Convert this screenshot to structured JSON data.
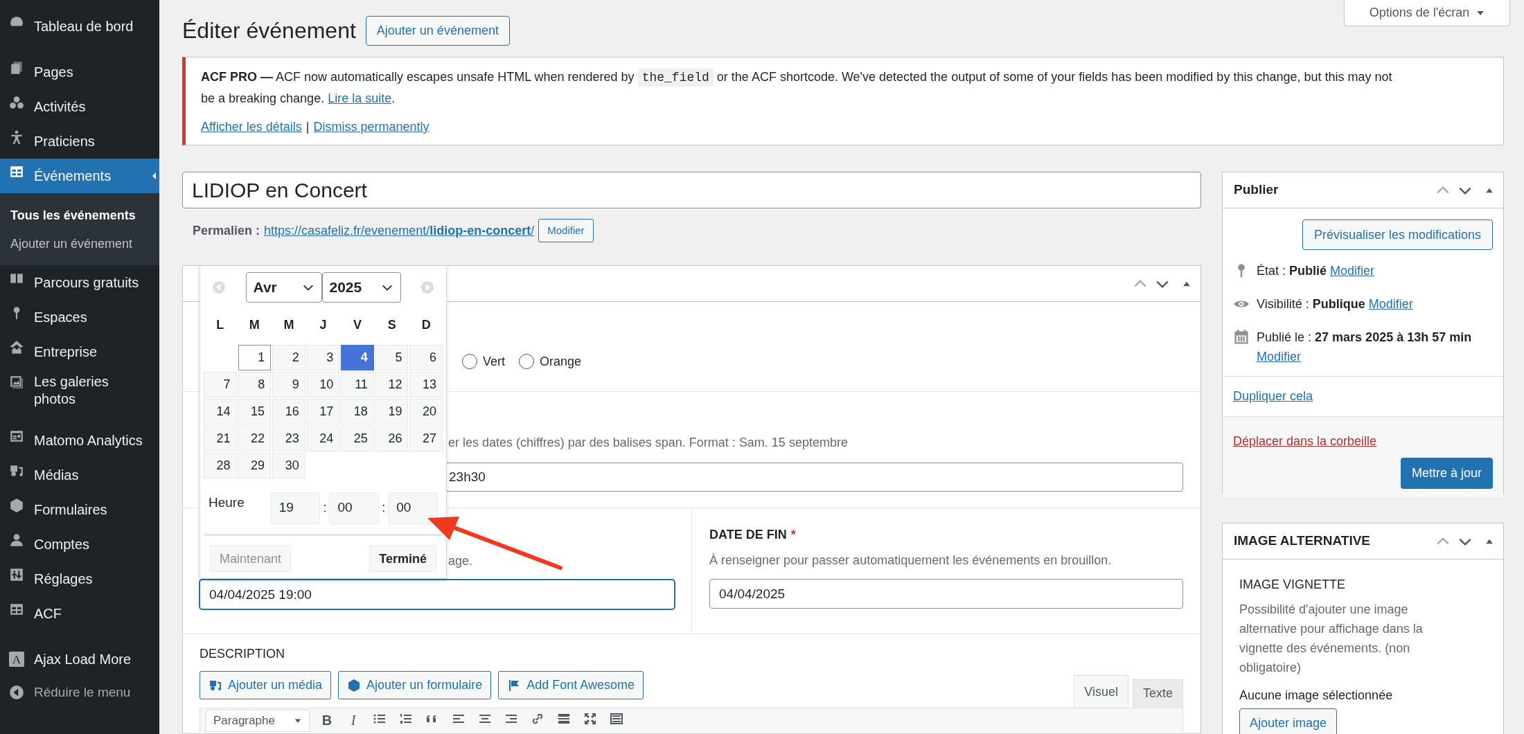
{
  "sidebar": {
    "groups": [
      [
        {
          "label": "Tableau de bord",
          "selected": false
        }
      ],
      [
        {
          "label": "Pages",
          "selected": false
        },
        {
          "label": "Activités",
          "selected": false
        },
        {
          "label": "Praticiens",
          "selected": false
        },
        {
          "label": "Événements",
          "selected": true,
          "children": [
            {
              "label": "Tous les événements",
              "selected": true
            },
            {
              "label": "Ajouter un événement",
              "selected": false
            }
          ]
        },
        {
          "label": "Parcours gratuits",
          "selected": false
        },
        {
          "label": "Espaces",
          "selected": false
        },
        {
          "label": "Entreprise",
          "selected": false
        },
        {
          "label": "Les galeries photos",
          "selected": false
        }
      ],
      [
        {
          "label": "Matomo Analytics",
          "selected": false
        },
        {
          "label": "Médias",
          "selected": false
        },
        {
          "label": "Formulaires",
          "selected": false
        },
        {
          "label": "Comptes",
          "selected": false
        },
        {
          "label": "Réglages",
          "selected": false
        },
        {
          "label": "ACF",
          "selected": false
        }
      ],
      [
        {
          "label": "Ajax Load More",
          "selected": false,
          "badge": "A"
        }
      ]
    ],
    "collapse": "Réduire le menu"
  },
  "screen_options": "Options de l'écran",
  "page": {
    "title": "Éditer événement",
    "add_button": "Ajouter un événement"
  },
  "notice": {
    "message": [
      {
        "kind": "text",
        "text": "**ACF PRO —** ACF now automatically escapes unsafe HTML when rendered by "
      },
      {
        "kind": "code",
        "text": "the_field"
      },
      {
        "kind": "text",
        "text": " or the ACF shortcode. We've detected the output of some of your fields has been modified by this change, but this may not be a breaking change. "
      },
      {
        "kind": "link",
        "text": "Lire la suite"
      },
      {
        "kind": "text",
        "text": "."
      }
    ],
    "actions": [
      "Afficher les détails",
      "Dismiss permanently"
    ],
    "separator": "|"
  },
  "post_title": "LIDIOP en Concert",
  "permalink": {
    "label": "Permalien :",
    "url": "https://casafeliz.fr/evenement/**lidiop-en-concert**/",
    "button": "Modifier"
  },
  "color_options": [
    {
      "label": "Vert",
      "selected": false
    },
    {
      "label": "Orange",
      "selected": false
    }
  ],
  "dates_text": {
    "hint": "er les dates (chiffres) par des balises span. Format : Sam. 15 septembre",
    "value": "23h30"
  },
  "start_date": {
    "hint": "age.",
    "value": "04/04/2025 19:00"
  },
  "end_date": {
    "label": "DATE DE FIN",
    "required": "*",
    "hint": "À renseigner pour passer automatiquement les événements en brouillon.",
    "value": "04/04/2025"
  },
  "datepicker": {
    "month": "Avr",
    "year": "2025",
    "weekdays": [
      "L",
      "M",
      "M",
      "J",
      "V",
      "S",
      "D"
    ],
    "weeks": [
      [
        {
          "day": "1",
          "today": true,
          "selected": false
        },
        {
          "day": "2",
          "today": false,
          "selected": false
        },
        {
          "day": "3",
          "today": false,
          "selected": false
        },
        {
          "day": "4",
          "today": false,
          "selected": true
        },
        {
          "day": "5",
          "today": false,
          "selected": false
        },
        {
          "day": "6",
          "today": false,
          "selected": false
        }
      ],
      [
        {
          "day": "7",
          "today": false,
          "selected": false
        },
        {
          "day": "8",
          "today": false,
          "selected": false
        },
        {
          "day": "9",
          "today": false,
          "selected": false
        },
        {
          "day": "10",
          "today": false,
          "selected": false
        },
        {
          "day": "11",
          "today": false,
          "selected": false
        },
        {
          "day": "12",
          "today": false,
          "selected": false
        },
        {
          "day": "13",
          "today": false,
          "selected": false
        }
      ],
      [
        {
          "day": "14",
          "today": false,
          "selected": false
        },
        {
          "day": "15",
          "today": false,
          "selected": false
        },
        {
          "day": "16",
          "today": false,
          "selected": false
        },
        {
          "day": "17",
          "today": false,
          "selected": false
        },
        {
          "day": "18",
          "today": false,
          "selected": false
        },
        {
          "day": "19",
          "today": false,
          "selected": false
        },
        {
          "day": "20",
          "today": false,
          "selected": false
        }
      ],
      [
        {
          "day": "21",
          "today": false,
          "selected": false
        },
        {
          "day": "22",
          "today": false,
          "selected": false
        },
        {
          "day": "23",
          "today": false,
          "selected": false
        },
        {
          "day": "24",
          "today": false,
          "selected": false
        },
        {
          "day": "25",
          "today": false,
          "selected": false
        },
        {
          "day": "26",
          "today": false,
          "selected": false
        },
        {
          "day": "27",
          "today": false,
          "selected": false
        }
      ],
      [
        {
          "day": "28",
          "today": false,
          "selected": false
        },
        {
          "day": "29",
          "today": false,
          "selected": false
        },
        {
          "day": "30",
          "today": false,
          "selected": false
        }
      ]
    ],
    "time_label": "Heure",
    "time_fields": [
      "19",
      "00",
      "00"
    ],
    "separators": [
      ":",
      ":"
    ],
    "now_button": "Maintenant",
    "done_button": "Terminé"
  },
  "description": {
    "label": "DESCRIPTION",
    "buttons": [
      "Ajouter un média",
      "Ajouter un formulaire",
      "Add Font Awesome"
    ],
    "tabs": [
      {
        "label": "Visuel",
        "selected": true
      },
      {
        "label": "Texte",
        "selected": false
      }
    ],
    "format_select": "Paragraphe",
    "format_buttons": [
      "B",
      "I"
    ]
  },
  "publish_box": {
    "title": "Publier",
    "preview_button": "Prévisualiser les modifications",
    "meta": [
      {
        "label": "État :",
        "value": "Publié",
        "link": "Modifier"
      },
      {
        "label": "Visibilité :",
        "value": "Publique",
        "link": "Modifier"
      },
      {
        "label": "Publié le :",
        "value": "27 mars 2025 à 13h 57 min",
        "link": "Modifier"
      }
    ],
    "duplicate": "Dupliquer cela",
    "trash": "Déplacer dans la corbeille",
    "update_button": "Mettre à jour"
  },
  "image_box": {
    "title": "IMAGE ALTERNATIVE",
    "field_label": "IMAGE VIGNETTE",
    "hint": "Possibilité d'ajouter une image alternative pour affichage dans la vignette des événements. (non obligatoire)",
    "empty_text": "Aucune image sélectionnée",
    "button": "Ajouter image"
  }
}
